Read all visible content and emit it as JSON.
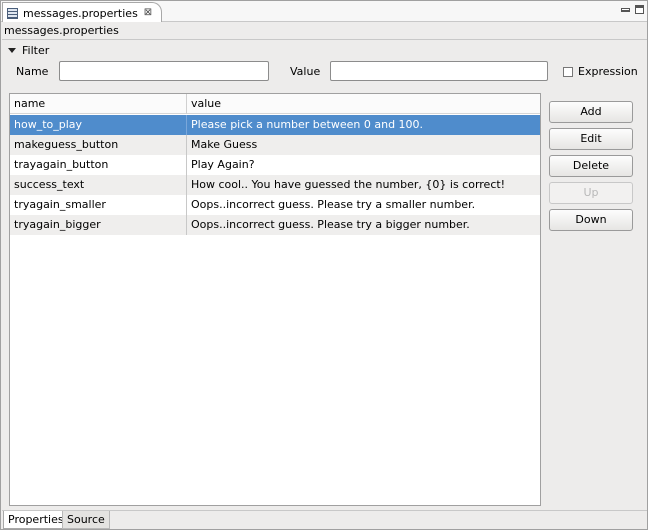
{
  "tab": {
    "title": "messages.properties",
    "close": "⊠"
  },
  "editor": {
    "file_header": "messages.properties"
  },
  "filter": {
    "toggle_label": "Filter",
    "name_label": "Name",
    "name_value": "",
    "value_label": "Value",
    "value_value": "",
    "expression_label": "Expression",
    "expression_checked": false
  },
  "table": {
    "headers": {
      "name": "name",
      "value": "value"
    },
    "rows": [
      {
        "name": "how_to_play",
        "value": "Please pick a number between 0 and 100."
      },
      {
        "name": "makeguess_button",
        "value": "Make Guess"
      },
      {
        "name": "trayagain_button",
        "value": "Play Again?"
      },
      {
        "name": "success_text",
        "value": "How cool.. You have guessed the number, {0} is correct!"
      },
      {
        "name": "tryagain_smaller",
        "value": "Oops..incorrect guess. Please try a smaller number."
      },
      {
        "name": "tryagain_bigger",
        "value": "Oops..incorrect guess. Please try a bigger number."
      }
    ],
    "selected_row": "how_to_play"
  },
  "buttons": {
    "add": "Add",
    "edit": "Edit",
    "delete": "Delete",
    "up": "Up",
    "down": "Down"
  },
  "bottom_tabs": {
    "properties": "Properties",
    "source": "Source"
  },
  "colors": {
    "selection": "#4f8ccc",
    "alt_row": "#efeeed"
  }
}
